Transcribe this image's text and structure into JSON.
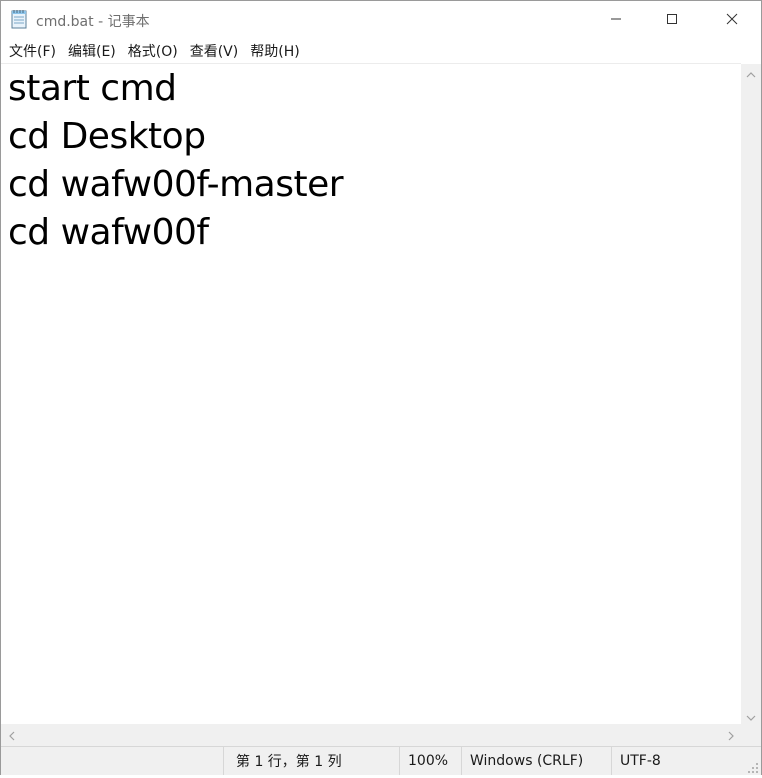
{
  "window": {
    "title": "cmd.bat - 记事本"
  },
  "icons": {
    "app": "notepad-icon",
    "minimize": "minimize-icon",
    "maximize": "maximize-icon",
    "close": "close-icon"
  },
  "menu": {
    "items": [
      {
        "label": "文件(F)"
      },
      {
        "label": "编辑(E)"
      },
      {
        "label": "格式(O)"
      },
      {
        "label": "查看(V)"
      },
      {
        "label": "帮助(H)"
      }
    ]
  },
  "editor": {
    "lines": [
      "start cmd",
      "cd Desktop",
      "cd wafw00f-master",
      "cd wafw00f"
    ]
  },
  "status": {
    "position": "第 1 行，第 1 列",
    "zoom": "100%",
    "line_ending": "Windows (CRLF)",
    "encoding": "UTF-8"
  },
  "colors": {
    "title_text": "#6f6f6f",
    "chrome_bg": "#f0f0f0",
    "editor_text": "#000000"
  }
}
